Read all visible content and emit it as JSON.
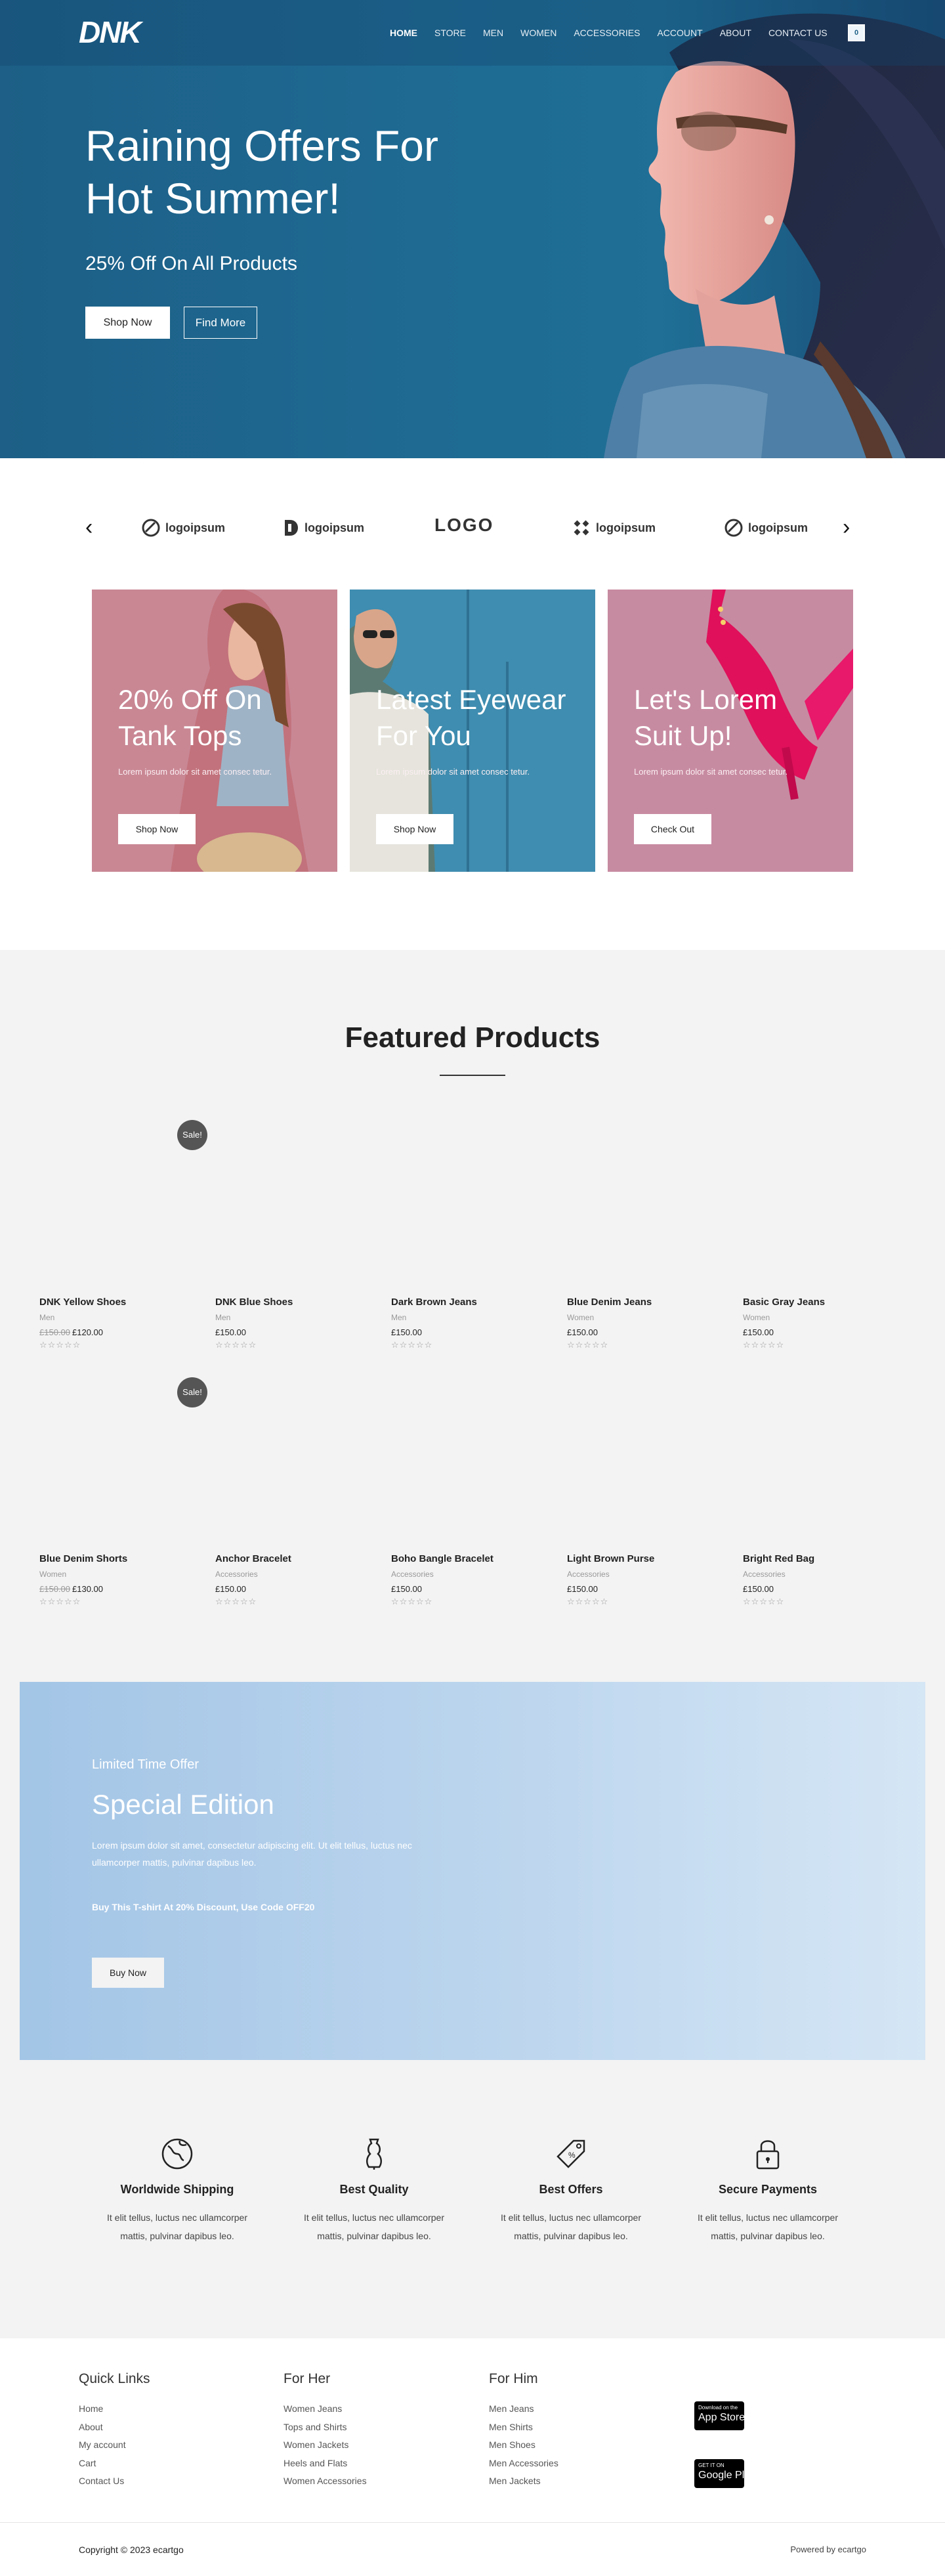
{
  "header": {
    "logo": "DNK",
    "nav": [
      "HOME",
      "STORE",
      "MEN",
      "WOMEN",
      "ACCESSORIES",
      "ACCOUNT",
      "ABOUT",
      "CONTACT US"
    ],
    "active_nav": "HOME",
    "cart_count": "0"
  },
  "hero": {
    "title": "Raining Offers For Hot Summer!",
    "subtitle": "25% Off On All Products",
    "shop_now": "Shop Now",
    "find_more": "Find More"
  },
  "logos": {
    "items": [
      "logoipsum",
      "logoipsum",
      "LOGO",
      "logoipsum",
      "logoipsum"
    ],
    "prev_icon": "chevron-left-icon",
    "next_icon": "chevron-right-icon"
  },
  "promo_cards": [
    {
      "title": "20% Off On Tank Tops",
      "text": "Lorem ipsum dolor sit amet consec tetur.",
      "button": "Shop Now"
    },
    {
      "title": "Latest Eyewear For You",
      "text": "Lorem ipsum dolor sit amet consec tetur.",
      "button": "Shop Now"
    },
    {
      "title": "Let's Lorem Suit Up!",
      "text": "Lorem ipsum dolor sit amet consec tetur.",
      "button": "Check Out"
    }
  ],
  "featured": {
    "title": "Featured Products",
    "sale_badge": "Sale!",
    "products": [
      {
        "name": "DNK Yellow Shoes",
        "category": "Men",
        "old_price": "£150.00",
        "price": "£120.00",
        "rating": "☆☆☆☆☆"
      },
      {
        "name": "DNK Blue Shoes",
        "category": "Men",
        "old_price": "",
        "price": "£150.00",
        "rating": "☆☆☆☆☆"
      },
      {
        "name": "Dark Brown Jeans",
        "category": "Men",
        "old_price": "",
        "price": "£150.00",
        "rating": "☆☆☆☆☆"
      },
      {
        "name": "Blue Denim Jeans",
        "category": "Women",
        "old_price": "",
        "price": "£150.00",
        "rating": "☆☆☆☆☆"
      },
      {
        "name": "Basic Gray Jeans",
        "category": "Women",
        "old_price": "",
        "price": "£150.00",
        "rating": "☆☆☆☆☆"
      },
      {
        "name": "Blue Denim Shorts",
        "category": "Women",
        "old_price": "£150.00",
        "price": "£130.00",
        "rating": "☆☆☆☆☆"
      },
      {
        "name": "Anchor Bracelet",
        "category": "Accessories",
        "old_price": "",
        "price": "£150.00",
        "rating": "☆☆☆☆☆"
      },
      {
        "name": "Boho Bangle Bracelet",
        "category": "Accessories",
        "old_price": "",
        "price": "£150.00",
        "rating": "☆☆☆☆☆"
      },
      {
        "name": "Light Brown Purse",
        "category": "Accessories",
        "old_price": "",
        "price": "£150.00",
        "rating": "☆☆☆☆☆"
      },
      {
        "name": "Bright Red Bag",
        "category": "Accessories",
        "old_price": "",
        "price": "£150.00",
        "rating": "☆☆☆☆☆"
      }
    ]
  },
  "special": {
    "eyebrow": "Limited Time Offer",
    "title": "Special Edition",
    "text": "Lorem ipsum dolor sit amet, consectetur adipiscing elit. Ut elit tellus, luctus nec ullamcorper mattis, pulvinar dapibus leo.",
    "code_text": "Buy This T-shirt At 20% Discount, Use Code OFF20",
    "button": "Buy Now"
  },
  "features": [
    {
      "icon": "globe-icon",
      "title": "Worldwide Shipping",
      "text": "It elit tellus, luctus nec ullamcorper mattis, pulvinar dapibus leo."
    },
    {
      "icon": "dress-form-icon",
      "title": "Best Quality",
      "text": "It elit tellus, luctus nec ullamcorper mattis, pulvinar dapibus leo."
    },
    {
      "icon": "price-tag-icon",
      "title": "Best Offers",
      "text": "It elit tellus, luctus nec ullamcorper mattis, pulvinar dapibus leo."
    },
    {
      "icon": "lock-icon",
      "title": "Secure Payments",
      "text": "It elit tellus, luctus nec ullamcorper mattis, pulvinar dapibus leo."
    }
  ],
  "footer": {
    "quick_links": {
      "title": "Quick Links",
      "links": [
        "Home",
        "About",
        "My account",
        "Cart",
        "Contact Us"
      ]
    },
    "for_her": {
      "title": "For Her",
      "links": [
        "Women Jeans",
        "Tops and Shirts",
        "Women Jackets",
        "Heels and Flats",
        "Women Accessories"
      ]
    },
    "for_him": {
      "title": "For Him",
      "links": [
        "Men Jeans",
        "Men Shirts",
        "Men Shoes",
        "Men Accessories",
        "Men Jackets"
      ]
    },
    "app_store": {
      "small": "Download on the",
      "big": "App Store"
    },
    "google_play": {
      "small": "GET IT ON",
      "big": "Google Play"
    },
    "copyright": "Copyright © 2023 ecartgo",
    "powered": "Powered by ecartgo"
  },
  "colors": {
    "hero_bg": "#1e6a93",
    "card1": "#c78593",
    "card2": "#3f8db0",
    "card3": "#c68ba0",
    "promo_bg": "#b2cfea"
  }
}
